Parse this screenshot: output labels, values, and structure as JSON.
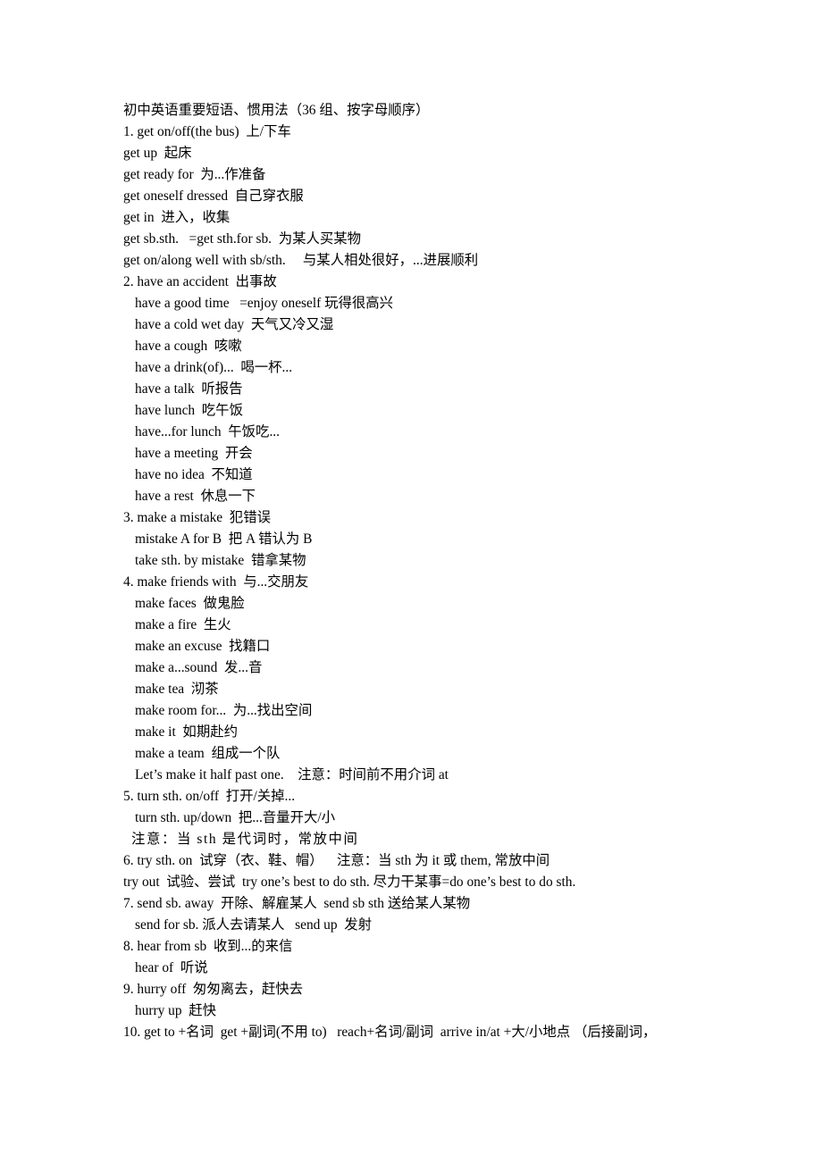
{
  "document": {
    "title": "初中英语重要短语、惯用法（36 组、按字母顺序）",
    "lines": [
      {
        "text": "初中英语重要短语、惯用法（36 组、按字母顺序）",
        "style": "title"
      },
      {
        "text": "1. get on/off(the bus)  上/下车",
        "style": "flush"
      },
      {
        "text": "get up  起床",
        "style": "flush"
      },
      {
        "text": "get ready for  为...作准备",
        "style": "flush"
      },
      {
        "text": "get oneself dressed  自己穿衣服",
        "style": "flush"
      },
      {
        "text": "get in  进入，收集",
        "style": "flush"
      },
      {
        "text": "get sb.sth.   =get sth.for sb.  为某人买某物",
        "style": "flush"
      },
      {
        "text": "get on/along well with sb/sth.     与某人相处很好，...进展顺利",
        "style": "flush"
      },
      {
        "text": "2. have an accident  出事故",
        "style": "flush"
      },
      {
        "text": "have a good time   =enjoy oneself 玩得很高兴",
        "style": "indent1"
      },
      {
        "text": "have a cold wet day  天气又冷又湿",
        "style": "indent1"
      },
      {
        "text": "have a cough  咳嗽",
        "style": "indent1"
      },
      {
        "text": "have a drink(of)...  喝一杯...",
        "style": "indent1"
      },
      {
        "text": "have a talk  听报告",
        "style": "indent1"
      },
      {
        "text": "have lunch  吃午饭",
        "style": "indent1"
      },
      {
        "text": "have...for lunch  午饭吃...",
        "style": "indent1"
      },
      {
        "text": "have a meeting  开会",
        "style": "indent1"
      },
      {
        "text": "have no idea  不知道",
        "style": "indent1"
      },
      {
        "text": "have a rest  休息一下",
        "style": "indent1"
      },
      {
        "text": "3. make a mistake  犯错误",
        "style": "flush"
      },
      {
        "text": "mistake A for B  把 A 错认为 B",
        "style": "indent1"
      },
      {
        "text": "take sth. by mistake  错拿某物",
        "style": "indent1"
      },
      {
        "text": "4. make friends with  与...交朋友",
        "style": "flush"
      },
      {
        "text": "make faces  做鬼脸",
        "style": "indent1"
      },
      {
        "text": "make a fire  生火",
        "style": "indent1"
      },
      {
        "text": "make an excuse  找籍口",
        "style": "indent1"
      },
      {
        "text": "make a...sound  发...音",
        "style": "indent1"
      },
      {
        "text": "make tea  沏茶",
        "style": "indent1"
      },
      {
        "text": "make room for...  为...找出空间",
        "style": "indent1"
      },
      {
        "text": "make it  如期赴约",
        "style": "indent1"
      },
      {
        "text": "make a team  组成一个队",
        "style": "indent1"
      },
      {
        "text": "Let’s make it half past one.    注意：时间前不用介词 at",
        "style": "indent1"
      },
      {
        "text": "5. turn sth. on/off  打开/关掉...",
        "style": "flush"
      },
      {
        "text": "turn sth. up/down  把...音量开大/小",
        "style": "indent1"
      },
      {
        "text": "注意：当 sth 是代词时，常放中间",
        "style": "indent-note"
      },
      {
        "text": "6. try sth. on  试穿（衣、鞋、帽）    注意：当 sth 为 it 或 them, 常放中间",
        "style": "flush"
      },
      {
        "text": "try out  试验、尝试  try one’s best to do sth. 尽力干某事=do one’s best to do sth.",
        "style": "flush"
      },
      {
        "text": "7. send sb. away  开除、解雇某人  send sb sth 送给某人某物",
        "style": "flush"
      },
      {
        "text": "send for sb. 派人去请某人   send up  发射",
        "style": "indent1"
      },
      {
        "text": "8. hear from sb  收到...的来信",
        "style": "flush"
      },
      {
        "text": "hear of  听说",
        "style": "indent1"
      },
      {
        "text": "9. hurry off  匆匆离去，赶快去",
        "style": "flush"
      },
      {
        "text": "hurry up  赶快",
        "style": "indent1"
      },
      {
        "text": "10. get to +名词  get +副词(不用 to)   reach+名词/副词  arrive in/at +大/小地点 （后接副词，",
        "style": "flush"
      }
    ]
  }
}
